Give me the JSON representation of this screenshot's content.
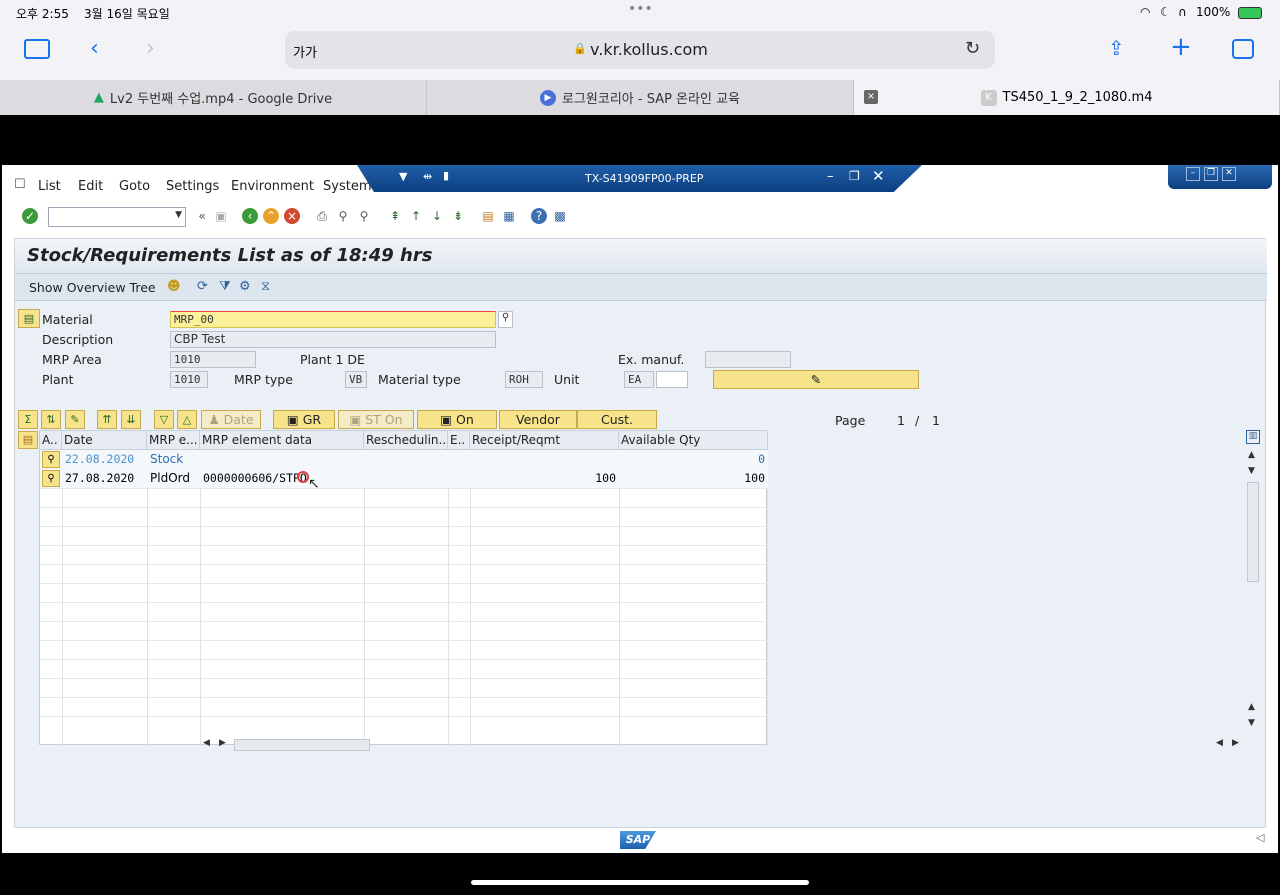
{
  "status": {
    "time": "오후 2:55",
    "date": "3월 16일 목요일",
    "battery": "100%"
  },
  "safari": {
    "text_size": "가가",
    "url": "v.kr.kollus.com"
  },
  "tabs": [
    {
      "label": "Lv2 두번째 수업.mp4 - Google Drive"
    },
    {
      "label": "로그원코리아 - SAP 온라인 교육"
    },
    {
      "label": "TS450_1_9_2_1080.m4"
    }
  ],
  "sap": {
    "menu": [
      "List",
      "Edit",
      "Goto",
      "Settings",
      "Environment",
      "System"
    ],
    "window_title": "TX-S41909FP00-PREP",
    "page_title": "Stock/Requirements List as of 18:49 hrs",
    "app_toolbar": {
      "overview_tree": "Show Overview Tree"
    },
    "form": {
      "material_label": "Material",
      "material_value": "MRP_00",
      "description_label": "Description",
      "description_value": "CBP Test",
      "mrp_area_label": "MRP Area",
      "mrp_area_value": "1010",
      "mrp_area_text": "Plant 1 DE",
      "ex_manuf_label": "Ex. manuf.",
      "plant_label": "Plant",
      "plant_value": "1010",
      "mrp_type_label": "MRP type",
      "mrp_type_value": "VB",
      "material_type_label": "Material type",
      "material_type_value": "ROH",
      "unit_label": "Unit",
      "unit_value": "EA"
    },
    "buttons": {
      "date": "Date",
      "gr": "GR",
      "st_on": "ST On",
      "on": "On",
      "vendor": "Vendor",
      "cust": "Cust."
    },
    "page": {
      "label": "Page",
      "current": "1",
      "sep": "/",
      "total": "1"
    },
    "grid": {
      "columns": [
        "A..",
        "Date",
        "MRP e...",
        "MRP element data",
        "Reschedulin...",
        "E..",
        "Receipt/Reqmt",
        "Available Qty"
      ],
      "rows": [
        {
          "date": "22.08.2020",
          "mrp_element": "Stock",
          "element_data": "",
          "receipt": "",
          "available": "0"
        },
        {
          "date": "27.08.2020",
          "mrp_element": "PldOrd",
          "element_data": "0000000606/STPO",
          "receipt": "100",
          "available": "100"
        }
      ]
    },
    "footer_logo": "SAP"
  }
}
